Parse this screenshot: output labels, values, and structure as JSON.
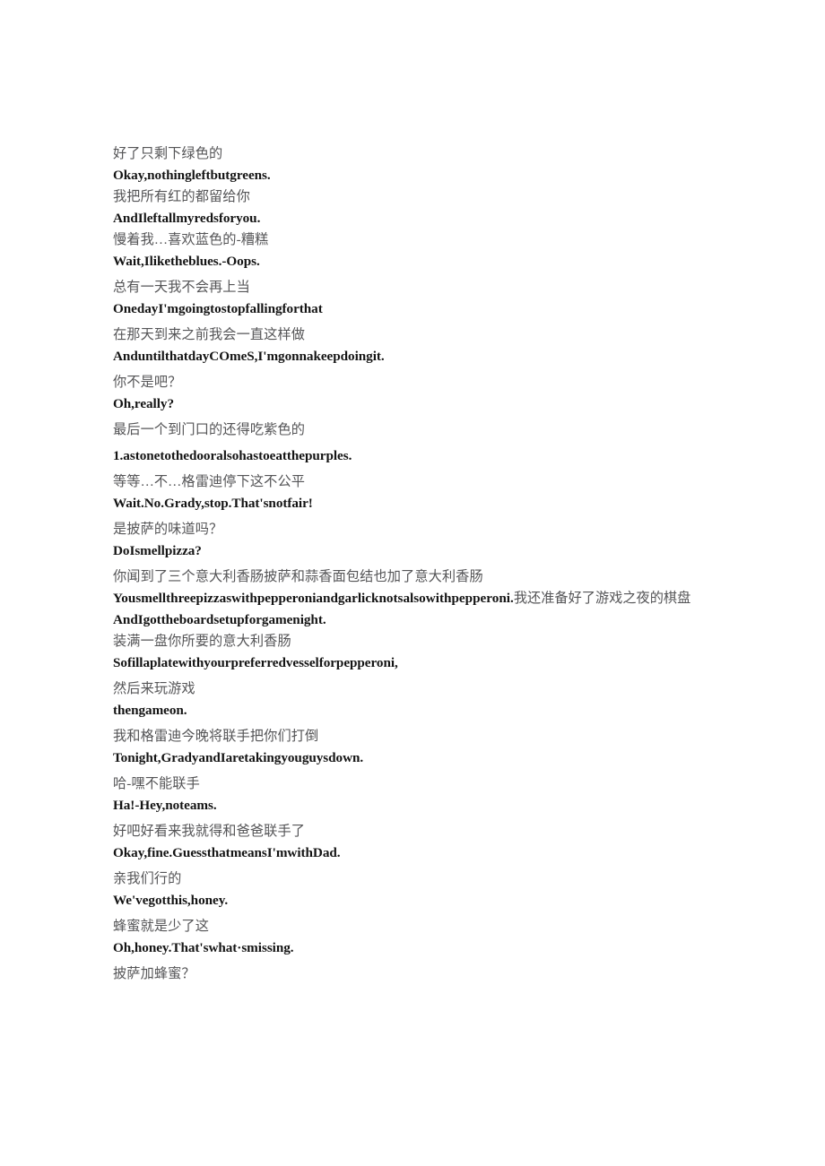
{
  "document": {
    "type": "bilingual-subtitle-transcript",
    "background_color": "#ffffff",
    "zh_text_color": "#555557",
    "en_text_color": "#141414",
    "blocks": [
      {
        "id": "block-1",
        "spacing": "tight",
        "pairs": [
          {
            "zh": "好了只剩下绿色的",
            "en": "Okay,nothingleftbutgreens."
          },
          {
            "zh": "我把所有红的都留给你",
            "en": "AndIleftallmyredsforyou."
          },
          {
            "zh": "慢着我…喜欢蓝色的-糟糕",
            "en": "Wait,Iliketheblues.-Oops."
          }
        ]
      },
      {
        "id": "block-2",
        "spacing": "loose",
        "pairs": [
          {
            "zh": "总有一天我不会再上当",
            "en": "OnedayI'mgoingtostopfallingforthat"
          },
          {
            "zh": "在那天到来之前我会一直这样做",
            "en": "AnduntilthatdayCOmeS,I'mgonnakeepdoingit."
          },
          {
            "zh": "你不是吧？",
            "en": "Oh,really?"
          },
          {
            "zh": "最后一个到门口的还得吃紫色的",
            "en": "1.astonetothedooralsohastoeatthepurples."
          },
          {
            "zh": "等等…不…格雷迪停下这不公平",
            "en": "Wait.No.Grady,stop.That'snotfair!"
          },
          {
            "zh": "是披萨的味道吗？",
            "en": "DoIsmellpizza?"
          }
        ]
      },
      {
        "id": "block-3",
        "spacing": "loose",
        "mixed_line": {
          "zh_header": "你闻到了三个意大利香肠披萨和蒜香面包结也加了意大利香肠",
          "en_part": "Yousmellthreepizzaswithpepperoniandgarlicknotsalsowithpepperoni.",
          "zh_trailing": "我还准备好了游戏之夜的棋盘",
          "en_following": "AndIgottheboardsetupforgamenight."
        }
      },
      {
        "id": "block-4",
        "spacing": "loose",
        "pairs": [
          {
            "zh": "装满一盘你所要的意大利香肠",
            "en": "Sofillaplatewithyourpreferredvesselforpepperoni,"
          },
          {
            "zh": "然后来玩游戏",
            "en": "thengameon."
          },
          {
            "zh": "我和格雷迪今晚将联手把你们打倒",
            "en": "Tonight,GradyandIaretakingyouguysdown."
          },
          {
            "zh": "哈-嘿不能联手",
            "en": "Ha!-Hey,noteams."
          },
          {
            "zh": "好吧好看来我就得和爸爸联手了",
            "en": "Okay,fine.GuessthatmeansI'mwithDad."
          },
          {
            "zh": "亲我们行的",
            "en": "We'vegotthis,honey."
          },
          {
            "zh": "蜂蜜就是少了这",
            "en": "Oh,honey.That'swhat·smissing."
          }
        ]
      },
      {
        "id": "block-5",
        "spacing": "loose",
        "pairs": [
          {
            "zh": "披萨加蜂蜜？",
            "en": ""
          }
        ]
      }
    ]
  }
}
